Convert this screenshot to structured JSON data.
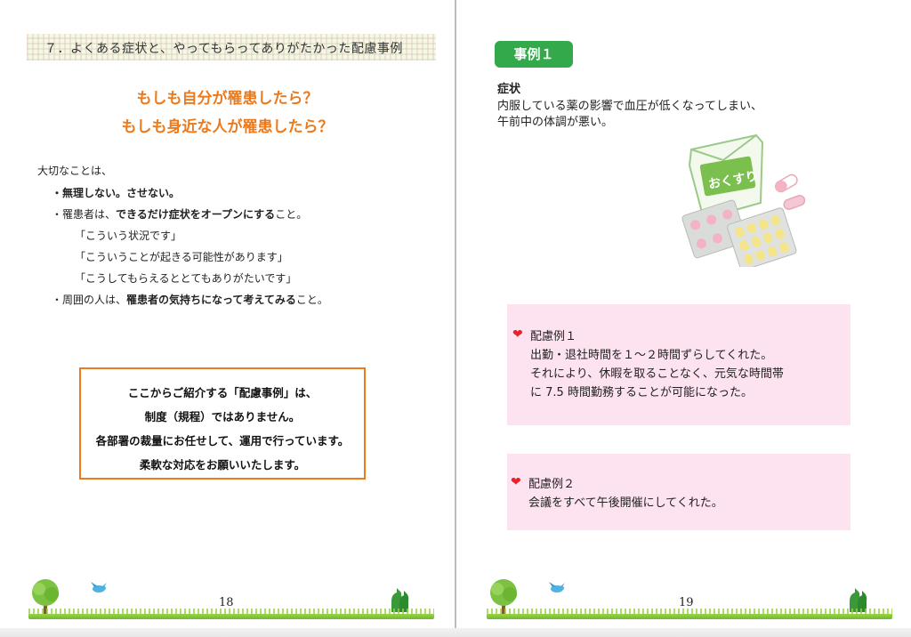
{
  "left_page": {
    "chapter_title": "７．よくある症状と、やってもらってありがたかった配慮事例",
    "headline_1": "もしも自分が罹患したら？",
    "headline_2": "もしも身近な人が罹患したら？",
    "intro": "大切なことは、",
    "bullet_1": "・無理しない。させない。",
    "bullet_2_prefix": "・罹患者は、",
    "bullet_2_bold": "できるだけ症状をオープンにする",
    "bullet_2_suffix": "こと。",
    "quote_1": "「こういう状況です」",
    "quote_2": "「こういうことが起きる可能性があります」",
    "quote_3": "「こうしてもらえるととてもありがたいです」",
    "bullet_3_prefix": "・周囲の人は、",
    "bullet_3_bold": "罹患者の気持ちになって考えてみる",
    "bullet_3_suffix": "こと。",
    "notice_lines": [
      "ここからご紹介する「配慮事例」は、",
      "制度（規程）ではありません。",
      "各部署の裁量にお任せして、運用で行っています。",
      "柔軟な対応をお願いいたします。"
    ],
    "page_number": "18"
  },
  "right_page": {
    "case_label": "事例１",
    "symptom_label": "症状",
    "symptom_lines": [
      "内服している薬の影響で血圧が低くなってしまい、",
      "午前中の体調が悪い。"
    ],
    "medicine_bag_text": "おくすり",
    "example_1": {
      "title": "配慮例１",
      "lines": [
        "出勤・退社時間を１～２時間ずらしてくれた。",
        "それにより、休暇を取ることなく、元気な時間帯",
        "に 7.5 時間勤務することが可能になった。"
      ]
    },
    "example_2": {
      "title": "配慮例２",
      "lines": [
        "会議をすべて午後開催にしてくれた。"
      ]
    },
    "page_number": "19"
  },
  "colors": {
    "headline": "#ec7a1d",
    "badge": "#33a94c",
    "pink_box": "#fde2f0",
    "heart": "#e8202a"
  },
  "icons": [
    "tree-icon",
    "bird-icon",
    "horses-icon",
    "heart-icon",
    "medicine-illustration"
  ]
}
